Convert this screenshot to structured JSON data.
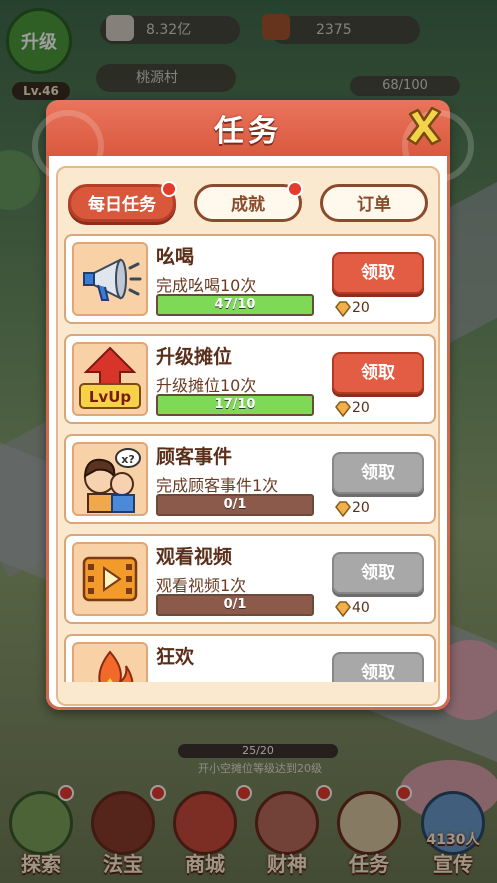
{
  "hud": {
    "level_button": "升级",
    "level": "Lv.46",
    "coins": "8.32亿",
    "gems": "2375",
    "location": "桃源村",
    "energy": "68/100"
  },
  "panel": {
    "title": "任务",
    "tabs": [
      {
        "label": "每日任务",
        "active": true,
        "badge": true
      },
      {
        "label": "成就",
        "active": false,
        "badge": true
      },
      {
        "label": "订单",
        "active": false,
        "badge": false
      }
    ],
    "tasks": [
      {
        "icon": "megaphone-icon",
        "name": "吆喝",
        "desc": "完成吆喝10次",
        "progress_text": "47/10",
        "progress": 1.0,
        "claim_label": "领取",
        "claimable": true,
        "reward": "20"
      },
      {
        "icon": "level-up-icon",
        "name": "升级摊位",
        "desc": "升级摊位10次",
        "progress_text": "17/10",
        "progress": 1.0,
        "claim_label": "领取",
        "claimable": true,
        "reward": "20"
      },
      {
        "icon": "customers-icon",
        "name": "顾客事件",
        "desc": "完成顾客事件1次",
        "progress_text": "0/1",
        "progress": 0.0,
        "claim_label": "领取",
        "claimable": false,
        "reward": "20"
      },
      {
        "icon": "video-icon",
        "name": "观看视频",
        "desc": "观看视频1次",
        "progress_text": "0/1",
        "progress": 0.0,
        "claim_label": "领取",
        "claimable": false,
        "reward": "40"
      },
      {
        "icon": "fire-icon",
        "name": "狂欢",
        "desc": "",
        "progress_text": "",
        "progress": 0.0,
        "claim_label": "领取",
        "claimable": false,
        "reward": ""
      }
    ]
  },
  "unlock": {
    "progress": "25/20",
    "tip": "开小空摊位等级达到20级"
  },
  "bottom_nav": [
    {
      "label": "探索"
    },
    {
      "label": "法宝"
    },
    {
      "label": "商城"
    },
    {
      "label": "财神"
    },
    {
      "label": "任务"
    },
    {
      "label": "宣传",
      "extra": "4130人"
    }
  ],
  "colors": {
    "accent": "#d9583c",
    "panel_bg": "#fbe9cf",
    "progress_done": "#7ed957",
    "progress_empty": "#8c5a4a",
    "disabled": "#a8a8a8"
  }
}
